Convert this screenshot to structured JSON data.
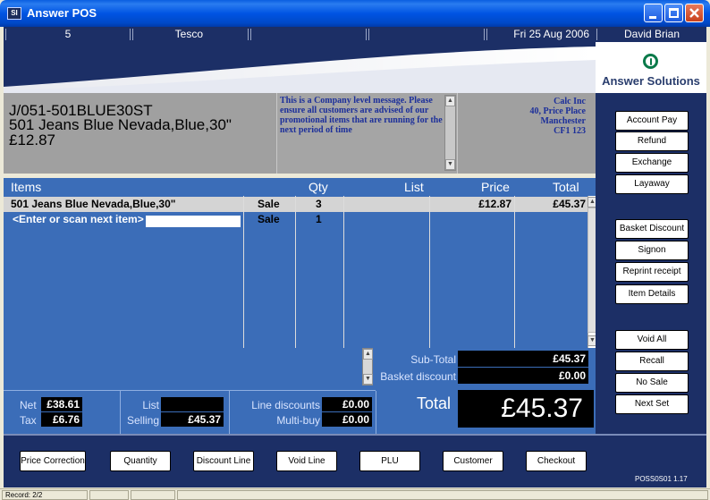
{
  "window": {
    "title": "Answer POS",
    "icon": "app-icon",
    "controls": [
      "minimize-icon",
      "maximize-icon",
      "close-icon"
    ]
  },
  "infobar": {
    "till": "5",
    "store": "Tesco",
    "col3": "",
    "col4": "",
    "date": "Fri 25 Aug 2006",
    "user": "David Brian"
  },
  "logo": {
    "text": "Answer Solutions"
  },
  "product": {
    "code": "J/051-501BLUE30ST",
    "description": "501 Jeans Blue Nevada,Blue,30\"",
    "price": "£12.87"
  },
  "message": "This is a Company level message. Please ensure all customers are advised of our promotional items that are running for the next period of time",
  "company": {
    "name": "Calc Inc",
    "address1": "40, Price Place",
    "city": "Manchester",
    "postcode": "CF1 123"
  },
  "grid": {
    "headers": {
      "items": "Items",
      "qty": "Qty",
      "list": "List",
      "price": "Price",
      "total": "Total"
    },
    "rows": [
      {
        "item": "501 Jeans Blue Nevada,Blue,30\"",
        "type": "Sale",
        "qty": "3",
        "list": "",
        "price": "£12.87",
        "total": "£45.37"
      },
      {
        "item": "<Enter or scan next item>",
        "type": "Sale",
        "qty": "1",
        "list": "",
        "price": "",
        "total": ""
      }
    ]
  },
  "totals": {
    "subtotal_label": "Sub-Total",
    "subtotal": "£45.37",
    "basket_discount_label": "Basket discount",
    "basket_discount": "£0.00",
    "total_label": "Total",
    "total": "£45.37",
    "net_label": "Net",
    "net": "£38.61",
    "tax_label": "Tax",
    "tax": "£6.76",
    "list_label": "List",
    "list": "",
    "selling_label": "Selling",
    "selling": "£45.37",
    "line_discounts_label": "Line discounts",
    "line_discounts": "£0.00",
    "multibuy_label": "Multi-buy",
    "multibuy": "£0.00"
  },
  "right_buttons": [
    "Account Pay",
    "Refund",
    "Exchange",
    "Layaway",
    "Basket Discount",
    "Signon",
    "Reprint receipt",
    "Item Details",
    "Void All",
    "Recall",
    "No Sale",
    "Next Set"
  ],
  "toolbar": [
    "Price Correction",
    "Quantity",
    "Discount Line",
    "Void Line",
    "PLU",
    "Customer",
    "Checkout"
  ],
  "version": "POSS0S01 1.17",
  "status": {
    "record": "Record: 2/2"
  },
  "colors": {
    "navy": "#1c2f66",
    "grid_blue": "#3b6db8",
    "message_blue": "#1c2f9a",
    "title_blue": "#0054e3"
  }
}
